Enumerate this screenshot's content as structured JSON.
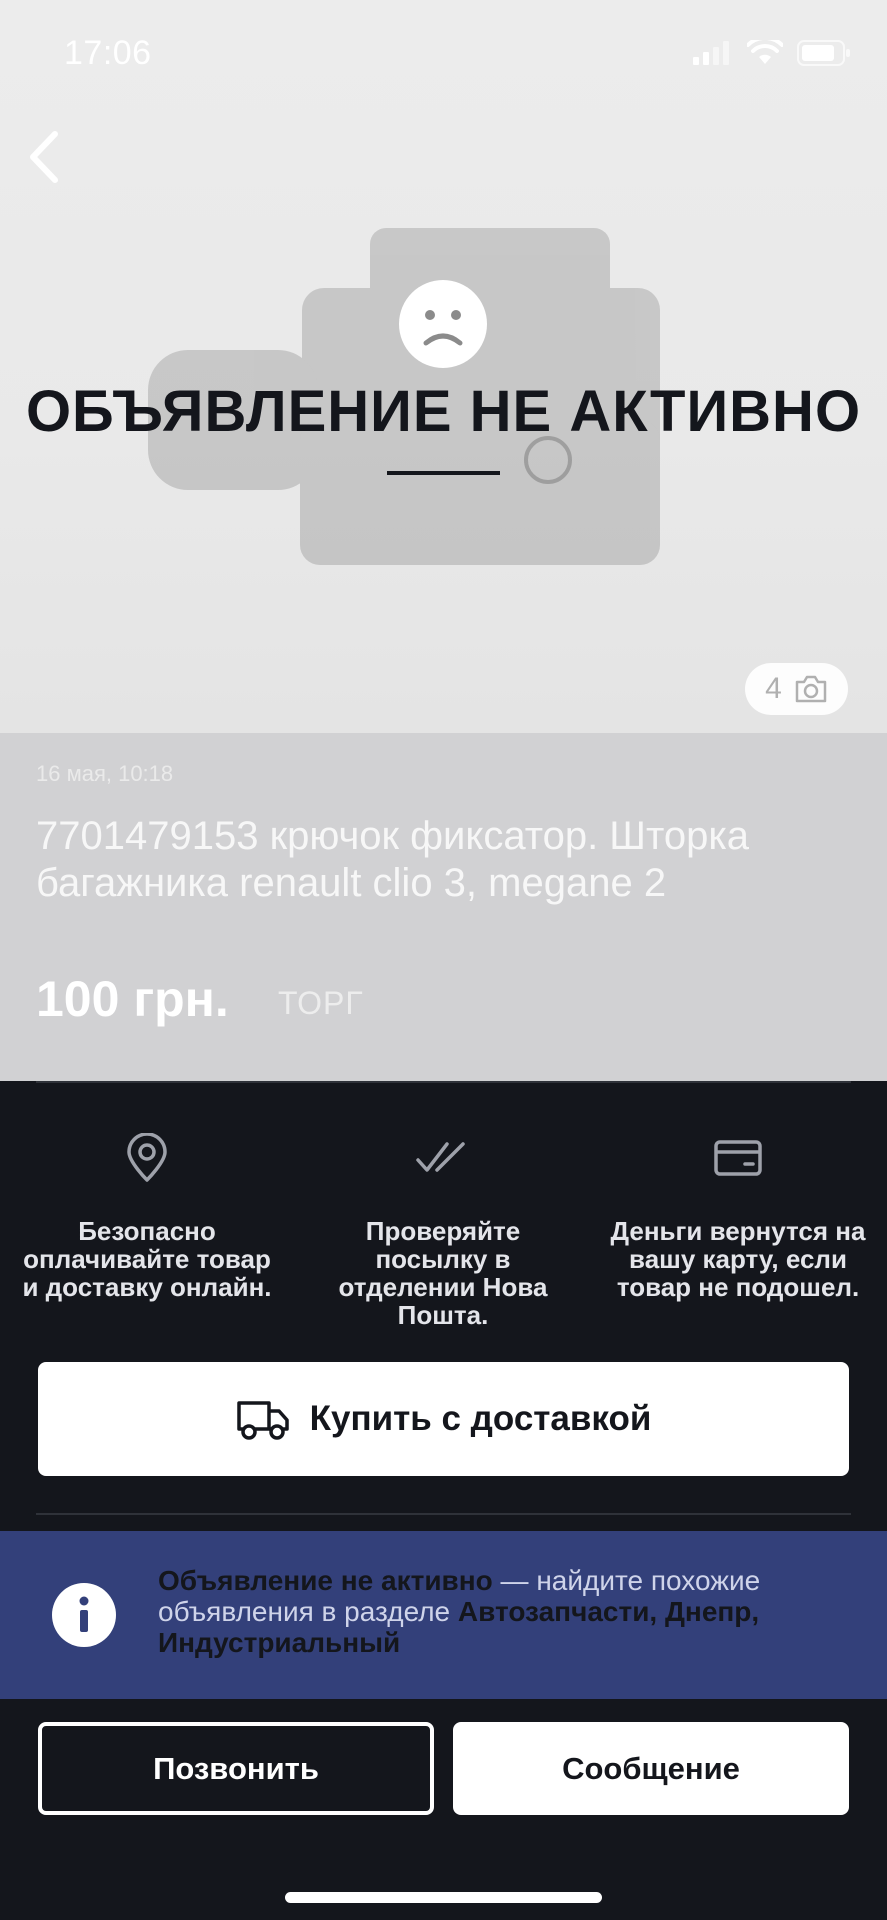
{
  "status_bar": {
    "time": "17:06",
    "icons": [
      "signal-icon",
      "wifi-icon",
      "battery-icon"
    ]
  },
  "hero": {
    "back_icon": "chevron-left-icon",
    "face_icon": "sad-face-icon",
    "inactive_title": "ОБЪЯВЛЕНИЕ НЕ АКТИВНО",
    "photo_count": "4",
    "photo_icon": "camera-icon"
  },
  "listing": {
    "date": "16 мая, 10:18",
    "title": "7701479153 крючок фиксатор. Шторка багажника renault clio 3, megane 2",
    "price": "100 грн.",
    "negotiable": "ТОРГ"
  },
  "benefits": [
    {
      "icon": "location-pin-icon",
      "text": "Безопасно оплачивайте товар и доставку онлайн."
    },
    {
      "icon": "double-check-icon",
      "text": "Проверяйте посылку в отделении Нова Пошта."
    },
    {
      "icon": "credit-card-icon",
      "text": "Деньги вернутся на вашу карту, если товар не подошел."
    }
  ],
  "buy_button": {
    "icon": "truck-icon",
    "label": "Купить с доставкой"
  },
  "info_banner": {
    "icon": "info-icon",
    "bold_lead": "Объявление не активно",
    "text": " — найдите похожие объявления в разделе ",
    "bold_category": "Автозапчасти, Днепр, Индустриальный"
  },
  "actions": {
    "call_label": "Позвонить",
    "message_label": "Сообщение"
  },
  "colors": {
    "dark_bg": "#14161c",
    "details_bg": "#d1d1d3",
    "banner_bg": "#33407a",
    "white": "#ffffff"
  }
}
